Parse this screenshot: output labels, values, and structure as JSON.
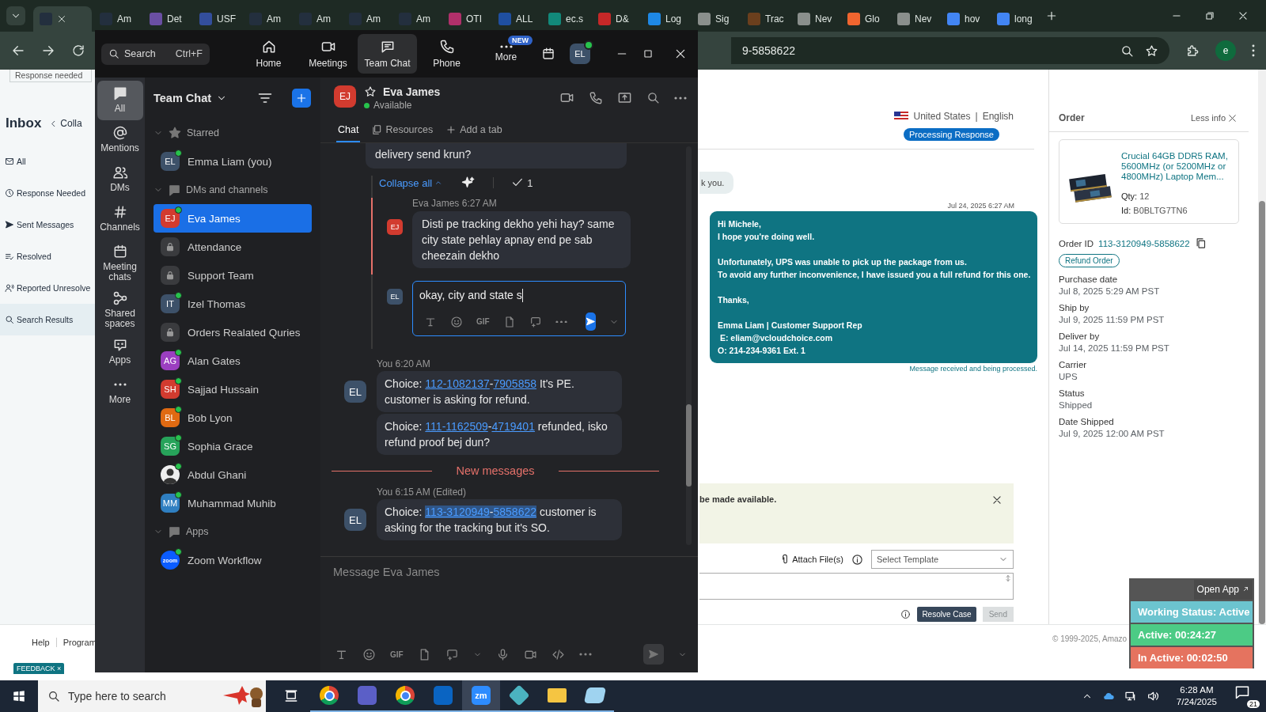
{
  "browser": {
    "tabs": [
      {
        "selected": true,
        "color": "#232f3e"
      },
      {
        "label": "Am",
        "selected": false,
        "color": "#232f3e"
      },
      {
        "label": "Det",
        "selected": false,
        "color": "#6a4fa3"
      },
      {
        "label": "USF",
        "selected": false,
        "color": "#334e9c"
      },
      {
        "label": "Am",
        "selected": false,
        "color": "#232f3e"
      },
      {
        "label": "Am",
        "selected": false,
        "color": "#232f3e"
      },
      {
        "label": "Am",
        "selected": false,
        "color": "#232f3e"
      },
      {
        "label": "Am",
        "selected": false,
        "color": "#232f3e"
      },
      {
        "label": "OTI",
        "selected": false,
        "color": "#b0306a"
      },
      {
        "label": "ALL",
        "selected": false,
        "color": "#1f4fa0"
      },
      {
        "label": "ec.s",
        "selected": false,
        "color": "#12897a"
      },
      {
        "label": "D&",
        "selected": false,
        "color": "#c62828"
      },
      {
        "label": "Log",
        "selected": false,
        "color": "#1e88e5"
      },
      {
        "label": "Sig",
        "selected": false,
        "color": "#8a8f8c"
      },
      {
        "label": "Trac",
        "selected": false,
        "color": "#6b3f1d"
      },
      {
        "label": "Nev",
        "selected": false,
        "color": "#8a8f8c"
      },
      {
        "label": "Glo",
        "selected": false,
        "color": "#f0652f"
      },
      {
        "label": "Nev",
        "selected": false,
        "color": "#8a8f8c"
      },
      {
        "label": "hov",
        "selected": false,
        "color": "#4285f4"
      },
      {
        "label": "long",
        "selected": false,
        "color": "#4285f4"
      }
    ],
    "address": "9-5858622",
    "profile_initial": "e"
  },
  "page": {
    "left_nav": {
      "top_card": "Response needed",
      "title": "Inbox",
      "collapse": "Colla",
      "folders": [
        {
          "label": "All",
          "selected": false
        },
        {
          "label": "Response Needed",
          "selected": false
        },
        {
          "label": "Sent Messages",
          "selected": false
        },
        {
          "label": "Resolved",
          "selected": false
        },
        {
          "label": "Reported Unresolve",
          "selected": false
        },
        {
          "label": "Search Results",
          "selected": true
        }
      ]
    },
    "thread": {
      "country": "United States",
      "separator": "|",
      "language": "English",
      "status": "Processing Response",
      "previous_message": "k you.",
      "timestamp": "Jul 24, 2025 6:27 AM",
      "message_paragraphs": [
        [
          "Hi Michele,",
          "I hope you're doing well."
        ],
        [
          "Unfortunately, UPS was unable to pick up the package from us.",
          "To avoid any further inconvenience, I have issued you a full refund for this one."
        ],
        [
          "Thanks,"
        ],
        [
          "Emma Liam | Customer Support Rep",
          " E: eliam@vcloudchoice.com",
          "O: 214-234-9361 Ext. 1"
        ]
      ],
      "delivery_note": "Message received and being processed.",
      "notice": "be made available.",
      "attach": "Attach File(s)",
      "template_placeholder": "Select Template",
      "resolve": "Resolve Case",
      "send": "Send",
      "send_disabled": true
    },
    "order": {
      "title": "Order",
      "less_info": "Less info",
      "product": {
        "title": "Crucial 64GB DDR5 RAM, 5600MHz (or 5200MHz or 4800MHz) Laptop Mem...",
        "qty_label": "Qty:",
        "qty": "12",
        "id_label": "Id:",
        "id": "B0BLTG7TN6"
      },
      "order_id_label": "Order ID",
      "order_id": "113-3120949-5858622",
      "refund": "Refund Order",
      "fields": [
        {
          "label": "Purchase date",
          "value": "Jul 8, 2025 5:29 AM PST"
        },
        {
          "label": "Ship by",
          "value": "Jul 9, 2025 11:59 PM PST"
        },
        {
          "label": "Deliver by",
          "value": "Jul 14, 2025 11:59 PM PST"
        },
        {
          "label": "Carrier",
          "value": "UPS"
        },
        {
          "label": "Status",
          "value": "Shipped"
        },
        {
          "label": "Date Shipped",
          "value": "Jul 9, 2025 12:00 AM PST"
        }
      ]
    },
    "footer": {
      "links": [
        "Help",
        "Program"
      ],
      "copyright": "© 1999-2025, Amazo",
      "feedback": "FEEDBACK ×"
    }
  },
  "zoom": {
    "search": "Search",
    "search_shortcut": "Ctrl+F",
    "nav": [
      {
        "label": "Home",
        "selected": false,
        "kind": "home"
      },
      {
        "label": "Meetings",
        "selected": false,
        "kind": "meetings"
      },
      {
        "label": "Team Chat",
        "selected": true,
        "kind": "chat"
      },
      {
        "label": "Phone",
        "selected": false,
        "kind": "phone"
      },
      {
        "label": "More",
        "selected": false,
        "kind": "more",
        "badge": "NEW"
      }
    ],
    "user": {
      "initials": "EL",
      "online": true
    },
    "rail": [
      {
        "label": "All",
        "selected": true,
        "kind": "all"
      },
      {
        "label": "Mentions",
        "selected": false,
        "kind": "mentions"
      },
      {
        "label": "DMs",
        "selected": false,
        "kind": "dms"
      },
      {
        "label": "Channels",
        "selected": false,
        "kind": "channels"
      },
      {
        "label": "Meeting chats",
        "selected": false,
        "kind": "meeting"
      },
      {
        "label": "Shared spaces",
        "selected": false,
        "kind": "shared"
      },
      {
        "label": "Apps",
        "selected": false,
        "kind": "apps"
      },
      {
        "label": "More",
        "selected": false,
        "kind": "more"
      }
    ],
    "list_title": "Team Chat",
    "sections": [
      {
        "title": "Starred",
        "kind": "star",
        "expanded": true,
        "items": [
          {
            "label": "Emma Liam (you)",
            "kind": "person",
            "initials": "EL",
            "color": "#3d5169",
            "online": true,
            "selected": false
          }
        ]
      },
      {
        "title": "DMs and channels",
        "kind": "bubble",
        "expanded": true,
        "items": [
          {
            "label": "Eva James",
            "kind": "person",
            "initials": "EJ",
            "color": "#d23b2f",
            "online": true,
            "selected": true
          },
          {
            "label": "Attendance",
            "kind": "lock",
            "online": false,
            "selected": false
          },
          {
            "label": "Support Team",
            "kind": "lock",
            "online": false,
            "selected": false
          },
          {
            "label": "Izel Thomas",
            "kind": "person",
            "initials": "IT",
            "color": "#3d5169",
            "online": true,
            "selected": false
          },
          {
            "label": "Orders Realated Quries",
            "kind": "lock",
            "online": false,
            "selected": false
          },
          {
            "label": "Alan Gates",
            "kind": "person",
            "initials": "AG",
            "color": "#9b3fc0",
            "online": true,
            "selected": false
          },
          {
            "label": "Sajjad Hussain",
            "kind": "person",
            "initials": "SH",
            "color": "#d23b2f",
            "online": true,
            "selected": false
          },
          {
            "label": "Bob Lyon",
            "kind": "person",
            "initials": "BL",
            "color": "#e06a12",
            "online": true,
            "selected": false
          },
          {
            "label": "Sophia Grace",
            "kind": "person",
            "initials": "SG",
            "color": "#27a35a",
            "online": true,
            "selected": false
          },
          {
            "label": "Abdul Ghani",
            "online": true,
            "selected": false
          },
          {
            "label": "Muhammad Muhib",
            "kind": "person",
            "initials": "MM",
            "color": "#2f7fc1",
            "online": true,
            "selected": false
          }
        ]
      },
      {
        "title": "Apps",
        "kind": "bubble",
        "expanded": true,
        "items": [
          {
            "label": "Zoom Workflow",
            "kind": "app",
            "badge": "zoom",
            "online": true,
            "selected": false
          }
        ]
      }
    ],
    "chat": {
      "contact": {
        "initials": "EJ",
        "color": "#d23b2f",
        "name": "Eva James",
        "status": "Available",
        "online": true,
        "starred": false
      },
      "tabs": [
        {
          "label": "Chat",
          "selected": true,
          "kind": "chat"
        },
        {
          "label": "Resources",
          "selected": false,
          "kind": "resources"
        },
        {
          "label": "Add a tab",
          "selected": false,
          "kind": "add"
        }
      ],
      "top_bubble": "delivery send krun?",
      "thread": {
        "collapse": "Collapse all",
        "check_count": "1",
        "reply": {
          "initials": "EJ",
          "color": "#d23b2f",
          "author": "Eva James",
          "time": "6:27 AM",
          "text": "Disti pe tracking dekho yehi hay? same city state pehlay apnay end pe sab cheezain dekho"
        },
        "draft": {
          "initials": "EL",
          "color": "#3d5169",
          "value": "okay, city and state s",
          "gif": "GIF"
        }
      },
      "groups": [
        {
          "author": "You",
          "time": "6:20 AM",
          "initials": "EL",
          "color": "#3d5169",
          "bubbles": [
            {
              "prefix": "Choice: ",
              "links": [
                {
                  "text": "112-1082137",
                  "highlighted": false
                },
                {
                  "text": "7905858",
                  "highlighted": false
                }
              ],
              "joiner": "-",
              "joiner_highlighted": false,
              "suffix": " It's PE. customer is asking for refund."
            },
            {
              "prefix": "Choice: ",
              "links": [
                {
                  "text": "111-1162509",
                  "highlighted": false
                },
                {
                  "text": "4719401",
                  "highlighted": false
                }
              ],
              "joiner": "-",
              "joiner_highlighted": false,
              "suffix": " refunded, isko refund proof bej dun?"
            }
          ]
        }
      ],
      "divider": "New messages",
      "new_groups": [
        {
          "author": "You",
          "time": "6:15 AM",
          "note": "(Edited)",
          "initials": "EL",
          "color": "#3d5169",
          "bubbles": [
            {
              "prefix": "Choice: ",
              "links": [
                {
                  "text": "113-3120949",
                  "highlighted": true
                },
                {
                  "text": "5858622",
                  "highlighted": true
                }
              ],
              "joiner": "-",
              "joiner_highlighted": true,
              "suffix": " customer is asking for the tracking but it's SO."
            }
          ]
        }
      ],
      "composer": {
        "placeholder": "Message Eva James",
        "gif": "GIF"
      }
    }
  },
  "tracker": {
    "open_app": "Open App",
    "rows": [
      {
        "text": "Working Status: Active",
        "color": "#6cc4cf"
      },
      {
        "text": "Active: 00:24:27",
        "color": "#4ccb85"
      },
      {
        "text": "In Active: 00:02:50",
        "color": "#e5735f"
      }
    ]
  },
  "taskbar": {
    "search_placeholder": "Type here to search",
    "apps": [
      {
        "kind": "chrome",
        "selected": false,
        "running": true
      },
      {
        "kind": "teams",
        "selected": false,
        "running": true
      },
      {
        "kind": "chrome",
        "selected": false,
        "running": true
      },
      {
        "kind": "outlook",
        "selected": false,
        "running": true
      },
      {
        "kind": "zoom",
        "label": "zm",
        "selected": true,
        "running": true
      },
      {
        "kind": "diamond",
        "selected": false,
        "running": true
      },
      {
        "kind": "folder",
        "selected": false,
        "running": true
      },
      {
        "kind": "notes",
        "selected": false,
        "running": true
      }
    ],
    "time": "6:28 AM",
    "date": "7/24/2025",
    "notifications": "21"
  }
}
